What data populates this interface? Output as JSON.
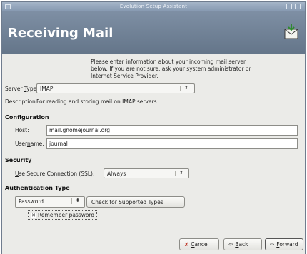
{
  "window": {
    "title": "Evolution Setup Assistant"
  },
  "header": {
    "heading": "Receiving Mail",
    "icon": "mail-envelope-icon"
  },
  "intro": "Please enter information about your incoming mail server below. If you are not sure, ask your system administrator or Internet Service Provider.",
  "server": {
    "type_label_pre": "Server ",
    "type_label_u": "T",
    "type_label_post": "ype:",
    "type_value": "IMAP",
    "description_label": "Description:",
    "description_value": "For reading and storing mail on IMAP servers."
  },
  "configuration": {
    "heading": "Configuration",
    "host_label_u": "H",
    "host_label_post": "ost:",
    "host_value": "mail.gnomejournal.org",
    "username_label_pre": "User",
    "username_label_u": "n",
    "username_label_post": "ame:",
    "username_value": "journal"
  },
  "security": {
    "heading": "Security",
    "ssl_label_u": "U",
    "ssl_label_post": "se Secure Connection (SSL):",
    "ssl_value": "Always"
  },
  "authentication": {
    "heading": "Authentication Type",
    "type_value": "Password",
    "check_label_pre": "Ch",
    "check_label_u": "e",
    "check_label_post": "ck for Supported Types",
    "remember_pre": "Re",
    "remember_u": "m",
    "remember_post": "ember password",
    "remember_checked": true
  },
  "footer": {
    "cancel_u": "C",
    "cancel_post": "ancel",
    "back_u": "B",
    "back_post": "ack",
    "forward_u": "F",
    "forward_post": "orward"
  }
}
